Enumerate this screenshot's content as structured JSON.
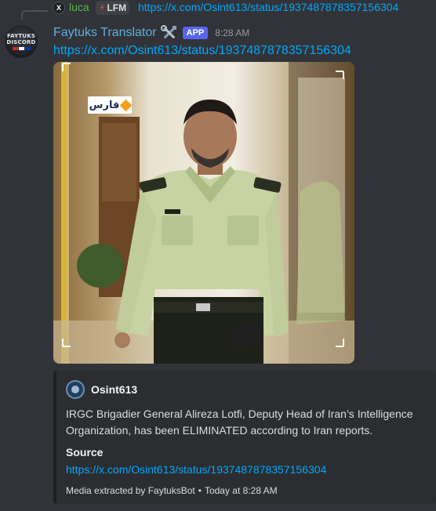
{
  "reply": {
    "avatar_glyph": "X",
    "author": "luca",
    "tag_icon": "lightning-icon",
    "tag_label": "LFM",
    "content": "https://x.com/Osint613/status/1937487878357156304"
  },
  "message": {
    "avatar_lines": [
      "FAYTUKS",
      "DISCORD"
    ],
    "author": "Faytuks Translator",
    "author_icon": "tools-icon",
    "badge": "APP",
    "timestamp": "8:28 AM",
    "content": "https://x.com/Osint613/status/1937487878357156304",
    "image_watermark": "فارس"
  },
  "embed": {
    "author": "Osint613",
    "description": "IRGC Brigadier General Alireza Lotfi, Deputy Head of Iran’s Intelligence Organization, has been ELIMINATED according to Iran reports.",
    "field_name": "Source",
    "field_value": "https://x.com/Osint613/status/1937487878357156304",
    "footer_text": "Media extracted by FaytuksBot",
    "footer_separator": "•",
    "footer_time": "Today at 8:28 AM"
  },
  "colors": {
    "background": "#313338",
    "username": "#5eaee0",
    "link": "#00a8fc",
    "badge": "#5865f2",
    "reply_name": "#58b44a",
    "embed_bg": "#2b2d31"
  }
}
